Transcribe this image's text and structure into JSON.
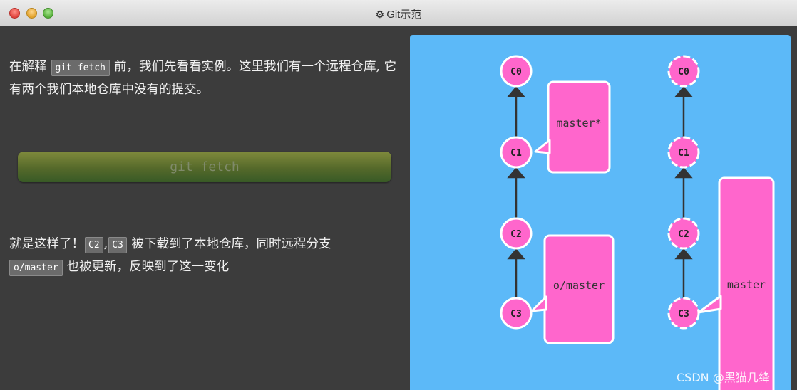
{
  "window": {
    "title": "Git示范",
    "gear_icon": "⚙"
  },
  "intro": {
    "before": "在解释",
    "code": "git fetch",
    "after": "前，我们先看看实例。这里我们有一个远程仓库, 它有两个我们本地仓库中没有的提交。"
  },
  "button": {
    "label": "git fetch"
  },
  "result": {
    "before": "就是这样了！",
    "code1": "C2",
    "sep": ",",
    "code2": "C3",
    "middle": "被下载到了本地仓库，同时远程分支",
    "code3": "o/master",
    "after": "也被更新，反映到了这一变化"
  },
  "graph": {
    "local": {
      "commits": [
        "C0",
        "C1",
        "C2",
        "C3"
      ],
      "branch_master": "master*",
      "branch_remote": "o/master"
    },
    "remote": {
      "commits": [
        "C0",
        "C1",
        "C2",
        "C3"
      ],
      "branch_master": "master"
    }
  },
  "colors": {
    "canvas": "#5cb9f8",
    "commit": "#ff66cc",
    "branch": "#ff66cc",
    "stroke": "#ffffff",
    "edge": "#333333"
  },
  "watermark": "CSDN @黑猫几绛"
}
